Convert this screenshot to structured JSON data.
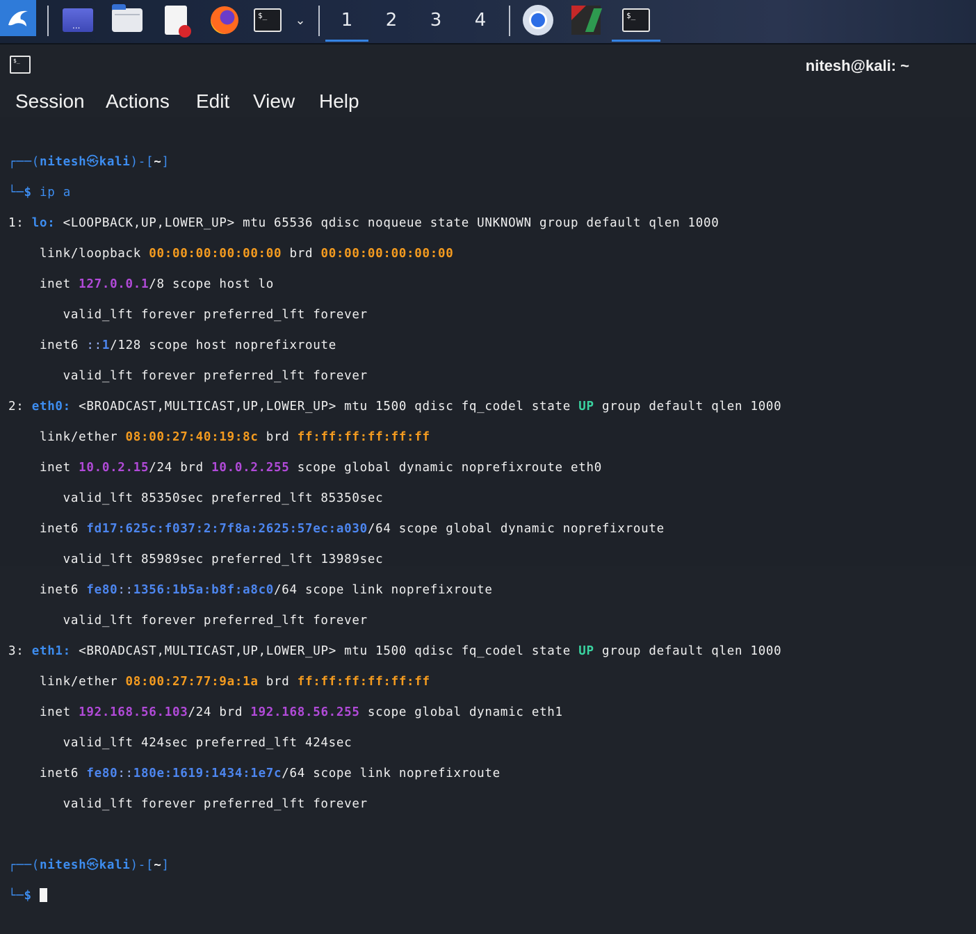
{
  "taskbar": {
    "workspaces": [
      "1",
      "2",
      "3",
      "4"
    ],
    "active_workspace": "1",
    "accent": "#3584e4",
    "app_icons": [
      "kali-menu-icon",
      "workspace-switcher-icon",
      "file-manager-icon",
      "text-editor-icon",
      "firefox-icon",
      "terminal-icon",
      "chevron-down-icon",
      "chromium-icon",
      "xampp-icon",
      "terminal-running-icon"
    ],
    "terminal_glyph": "$_",
    "workspace_dots": "..."
  },
  "window": {
    "title": "nitesh@kali: ~",
    "icon_glyph": "$_"
  },
  "menu": {
    "items": [
      "Session",
      "Actions",
      "Edit",
      "View",
      "Help"
    ]
  },
  "terminal": {
    "colors": {
      "prompt": "#3d8df0",
      "mac": "#f49b1f",
      "ipv4": "#b14ad8",
      "up": "#3ad3a0",
      "ipv6": "#4d86ef",
      "text": "#f0f0f0"
    },
    "prompt": {
      "top_left": "┌──(",
      "user": "nitesh",
      "at": "㉿",
      "host": "kali",
      "close": ")-[",
      "dir": "~",
      "end": "]",
      "bottom_left": "└─",
      "dollar": "$"
    },
    "command": "ip a",
    "lines": {
      "l1_idx": "1: ",
      "l1_if": "lo:",
      "l1_rest": " <LOOPBACK,UP,LOWER_UP> mtu 65536 qdisc noqueue state UNKNOWN group default qlen 1000",
      "l2_pre": "    link/loopback ",
      "l2_mac": "00:00:00:00:00:00",
      "l2_brd": " brd ",
      "l2_bmac": "00:00:00:00:00:00",
      "l3_pre": "    inet ",
      "l3_ip": "127.0.0.1",
      "l3_rest": "/8 scope host lo",
      "l4": "       valid_lft forever preferred_lft forever",
      "l5_pre": "    inet6 ",
      "l5_ip_a": "::",
      "l5_ip_b": "1",
      "l5_rest": "/128 scope host noprefixroute",
      "l6": "       valid_lft forever preferred_lft forever",
      "l7_idx": "2: ",
      "l7_if": "eth0:",
      "l7_a": " <BROADCAST,MULTICAST,UP,LOWER_UP> mtu 1500 qdisc fq_codel state ",
      "l7_up": "UP",
      "l7_b": " group default qlen 1000",
      "l8_pre": "    link/ether ",
      "l8_mac": "08:00:27:40:19:8c",
      "l8_brd": " brd ",
      "l8_bmac": "ff:ff:ff:ff:ff:ff",
      "l9_pre": "    inet ",
      "l9_ip": "10.0.2.15",
      "l9_mid": "/24 brd ",
      "l9_brd": "10.0.2.255",
      "l9_rest": " scope global dynamic noprefixroute eth0",
      "l10": "       valid_lft 85350sec preferred_lft 85350sec",
      "l11_pre": "    inet6 ",
      "l11_ip": "fd17:625c:f037:2:7f8a:2625:57ec:a030",
      "l11_rest": "/64 scope global dynamic noprefixroute",
      "l12": "       valid_lft 85989sec preferred_lft 13989sec",
      "l13_pre": "    inet6 ",
      "l13_ip_a": "fe80",
      "l13_ip_b": "::",
      "l13_ip_c": "1356:1b5a:b8f:a8c0",
      "l13_rest": "/64 scope link noprefixroute",
      "l14": "       valid_lft forever preferred_lft forever",
      "l15_idx": "3: ",
      "l15_if": "eth1:",
      "l15_a": " <BROADCAST,MULTICAST,UP,LOWER_UP> mtu 1500 qdisc fq_codel state ",
      "l15_up": "UP",
      "l15_b": " group default qlen 1000",
      "l16_pre": "    link/ether ",
      "l16_mac": "08:00:27:77:9a:1a",
      "l16_brd": " brd ",
      "l16_bmac": "ff:ff:ff:ff:ff:ff",
      "l17_pre": "    inet ",
      "l17_ip": "192.168.56.103",
      "l17_mid": "/24 brd ",
      "l17_brd": "192.168.56.255",
      "l17_rest": " scope global dynamic eth1",
      "l18": "       valid_lft 424sec preferred_lft 424sec",
      "l19_pre": "    inet6 ",
      "l19_ip_a": "fe80",
      "l19_ip_b": "::",
      "l19_ip_c": "180e:1619:1434:1e7c",
      "l19_rest": "/64 scope link noprefixroute",
      "l20": "       valid_lft forever preferred_lft forever"
    }
  }
}
